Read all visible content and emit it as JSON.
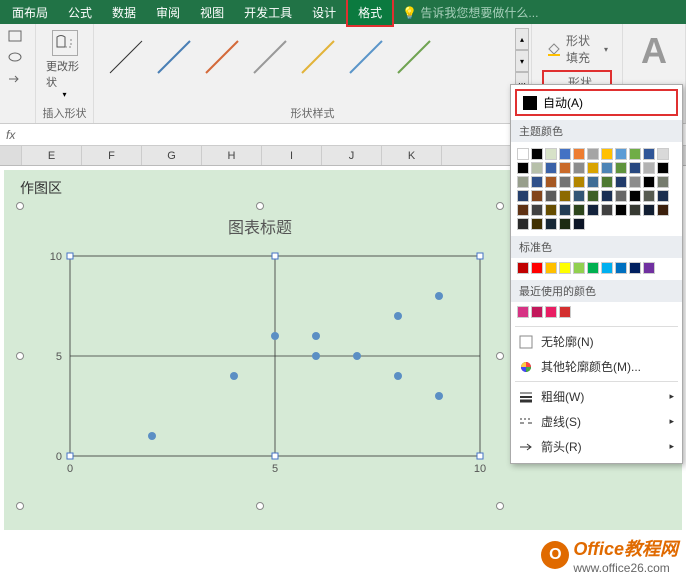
{
  "tabs": {
    "layout": "面布局",
    "formula": "公式",
    "data": "数据",
    "review": "审阅",
    "view": "视图",
    "dev": "开发工具",
    "design": "设计",
    "format": "格式"
  },
  "tellme": "告诉我您想要做什么...",
  "ribbon": {
    "edit_shape": "更改形状",
    "insert_shape": "插入形状",
    "shape_styles": "形状样式",
    "shape_fill": "形状填充",
    "shape_outline": "形状轮廓"
  },
  "popup": {
    "auto": "自动(A)",
    "theme_colors": "主题颜色",
    "standard_colors": "标准色",
    "recent_colors": "最近使用的颜色",
    "no_outline": "无轮廓(N)",
    "more_colors": "其他轮廓颜色(M)...",
    "weight": "粗细(W)",
    "dashes": "虚线(S)",
    "arrows": "箭头(R)",
    "theme_row": [
      "#ffffff",
      "#000000",
      "#d7e2c8",
      "#4472c4",
      "#ed7d31",
      "#a5a5a5",
      "#ffc000",
      "#5b9bd5",
      "#70ad47",
      "#2f5597"
    ],
    "std_row": [
      "#c00000",
      "#ff0000",
      "#ffc000",
      "#ffff00",
      "#92d050",
      "#00b050",
      "#00b0f0",
      "#0070c0",
      "#002060",
      "#7030a0"
    ],
    "recent": [
      "#d63384",
      "#c2185b",
      "#e91e63",
      "#d32f2f"
    ]
  },
  "fx": "fx",
  "columns": [
    "",
    "E",
    "F",
    "G",
    "H",
    "I",
    "J",
    "K"
  ],
  "plot_label": "作图区",
  "chart_data": {
    "type": "scatter",
    "title": "图表标题",
    "xlabel": "",
    "ylabel": "",
    "xlim": [
      0,
      10
    ],
    "ylim": [
      0,
      10
    ],
    "x_ticks": [
      0,
      5,
      10
    ],
    "y_ticks": [
      0,
      5,
      10
    ],
    "points": [
      {
        "x": 2.0,
        "y": 1.0
      },
      {
        "x": 4.0,
        "y": 4.0
      },
      {
        "x": 5.0,
        "y": 6.0
      },
      {
        "x": 6.0,
        "y": 6.0
      },
      {
        "x": 6.0,
        "y": 5.0
      },
      {
        "x": 7.0,
        "y": 5.0
      },
      {
        "x": 8.0,
        "y": 4.0
      },
      {
        "x": 8.0,
        "y": 7.0
      },
      {
        "x": 9.0,
        "y": 3.0
      },
      {
        "x": 9.0,
        "y": 8.0
      }
    ]
  },
  "watermark": {
    "brand": "Office教程网",
    "url": "www.office26.com"
  }
}
